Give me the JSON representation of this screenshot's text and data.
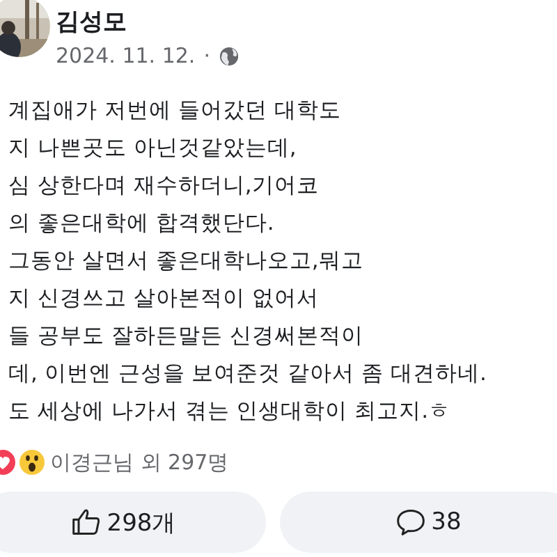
{
  "post": {
    "author": "김성모",
    "date": "2024. 11. 12.",
    "separator": "·",
    "lines": [
      "계집애가 저번에 들어갔던 대학도",
      "지 나쁜곳도 아닌것같았는데,",
      "심 상한다며 재수하더니,기어코",
      "의 좋은대학에 합격했단다.",
      "그동안 살면서 좋은대학나오고,뭐고",
      "지 신경쓰고 살아본적이 없어서",
      "들 공부도 잘하든말든 신경써본적이",
      "데, 이번엔 근성을 보여준것 같아서 좀 대견하네.",
      "도 세상에 나가서 겪는 인생대학이 최고지.ㅎ"
    ]
  },
  "reactions": {
    "summary": "이경근님 외 297명"
  },
  "actions": [
    {
      "kind": "like",
      "label": "298개"
    },
    {
      "kind": "comment",
      "label": "38"
    }
  ]
}
